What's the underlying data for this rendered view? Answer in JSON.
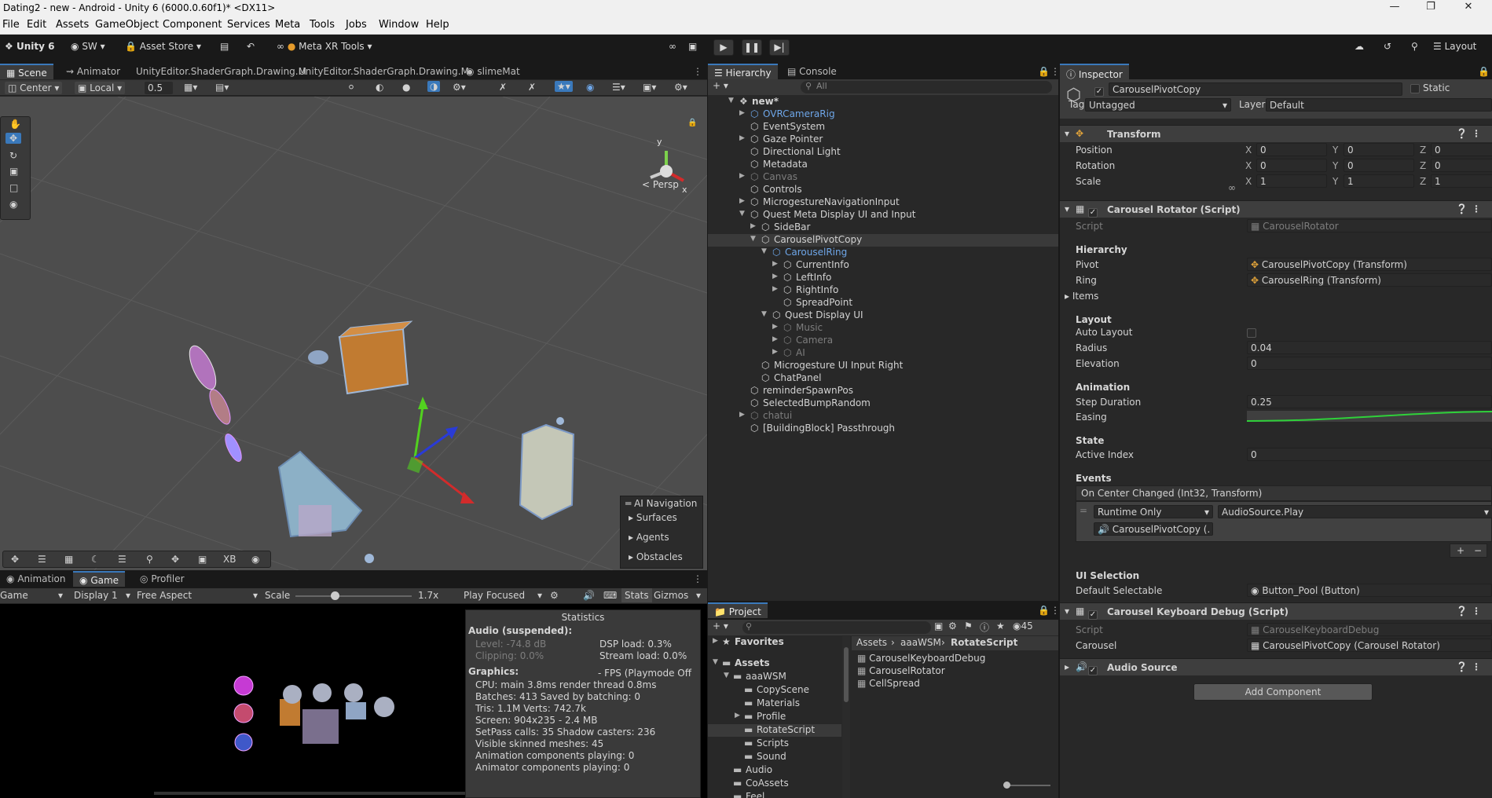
{
  "window": {
    "title": "Dating2 - new - Android - Unity 6 (6000.0.60f1)* <DX11>"
  },
  "menu": [
    "File",
    "Edit",
    "Assets",
    "GameObject",
    "Component",
    "Services",
    "Meta",
    "Tools",
    "Jobs",
    "Window",
    "Help"
  ],
  "toolbar": {
    "unity_label": "Unity 6",
    "account": "SW",
    "asset_store": "Asset Store",
    "meta_xr": "Meta XR Tools",
    "layout": "Layout"
  },
  "scene_tabs": {
    "scene": "Scene",
    "animator": "Animator",
    "shader1": "UnityEditor.ShaderGraph.Drawing.M",
    "shader2": "UnityEditor.ShaderGraph.Drawing.M",
    "slime": "slimeMat"
  },
  "scene_toolbar": {
    "pivot": "Center",
    "space": "Local",
    "snap": "0.5"
  },
  "scene_view": {
    "persp": "< Persp",
    "gizmo_y": "y",
    "gizmo_x": "x",
    "ai_nav_title": "AI Navigation",
    "ai_nav_items": [
      "Surfaces",
      "Agents",
      "Obstacles"
    ],
    "bottom_tool_xb": "XB"
  },
  "game_tabs": {
    "animation": "Animation",
    "game": "Game",
    "profiler": "Profiler"
  },
  "game_toolbar": {
    "mode": "Game",
    "display": "Display 1",
    "aspect": "Free Aspect",
    "scale_label": "Scale",
    "scale_value": "1.7x",
    "play_mode": "Play Focused",
    "stats": "Stats",
    "gizmos": "Gizmos"
  },
  "stats": {
    "title": "Statistics",
    "audio_head": "Audio (suspended):",
    "level": "Level: -74.8 dB",
    "clipping": "Clipping: 0.0%",
    "dsp": "DSP load: 0.3%",
    "stream": "Stream load: 0.0%",
    "graphics_head": "Graphics:",
    "fps": "- FPS (Playmode Off",
    "cpu": "CPU: main 3.8ms  render thread 0.8ms",
    "batches": "Batches: 413     Saved by batching: 0",
    "tris": "Tris: 1.1M   Verts: 742.7k",
    "screen": "Screen: 904x235 - 2.4 MB",
    "setpass": "SetPass calls: 35      Shadow casters: 236",
    "skinned": "Visible skinned meshes: 45",
    "anim": "Animation components playing: 0",
    "animator": "Animator components playing: 0"
  },
  "hierarchy": {
    "tab": "Hierarchy",
    "console_tab": "Console",
    "search_placeholder": "All",
    "items": [
      {
        "label": "new*",
        "indent": 0,
        "arrow": "▼",
        "style": "bold"
      },
      {
        "label": "OVRCameraRig",
        "indent": 1,
        "arrow": "▶",
        "style": "blue"
      },
      {
        "label": "EventSystem",
        "indent": 1,
        "arrow": "",
        "style": ""
      },
      {
        "label": "Gaze Pointer",
        "indent": 1,
        "arrow": "▶",
        "style": ""
      },
      {
        "label": "Directional Light",
        "indent": 1,
        "arrow": "",
        "style": ""
      },
      {
        "label": "Metadata",
        "indent": 1,
        "arrow": "",
        "style": ""
      },
      {
        "label": "Canvas",
        "indent": 1,
        "arrow": "▶",
        "style": "dim"
      },
      {
        "label": "Controls",
        "indent": 1,
        "arrow": "",
        "style": ""
      },
      {
        "label": "MicrogestureNavigationInput",
        "indent": 1,
        "arrow": "▶",
        "style": ""
      },
      {
        "label": "Quest Meta Display UI and Input",
        "indent": 1,
        "arrow": "▼",
        "style": ""
      },
      {
        "label": "SideBar",
        "indent": 2,
        "arrow": "▶",
        "style": ""
      },
      {
        "label": "CarouselPivotCopy",
        "indent": 2,
        "arrow": "▼",
        "style": "sel"
      },
      {
        "label": "CarouselRing",
        "indent": 3,
        "arrow": "▼",
        "style": "blue"
      },
      {
        "label": "CurrentInfo",
        "indent": 4,
        "arrow": "▶",
        "style": ""
      },
      {
        "label": "LeftInfo",
        "indent": 4,
        "arrow": "▶",
        "style": ""
      },
      {
        "label": "RightInfo",
        "indent": 4,
        "arrow": "▶",
        "style": ""
      },
      {
        "label": "SpreadPoint",
        "indent": 4,
        "arrow": "",
        "style": ""
      },
      {
        "label": "Quest Display UI",
        "indent": 3,
        "arrow": "▼",
        "style": ""
      },
      {
        "label": "Music",
        "indent": 4,
        "arrow": "▶",
        "style": "dim"
      },
      {
        "label": "Camera",
        "indent": 4,
        "arrow": "▶",
        "style": "dim"
      },
      {
        "label": "AI",
        "indent": 4,
        "arrow": "▶",
        "style": "dim"
      },
      {
        "label": "Microgesture UI Input Right",
        "indent": 2,
        "arrow": "",
        "style": ""
      },
      {
        "label": "ChatPanel",
        "indent": 2,
        "arrow": "",
        "style": ""
      },
      {
        "label": "reminderSpawnPos",
        "indent": 1,
        "arrow": "",
        "style": ""
      },
      {
        "label": "SelectedBumpRandom",
        "indent": 1,
        "arrow": "",
        "style": ""
      },
      {
        "label": "chatui",
        "indent": 1,
        "arrow": "▶",
        "style": "dim"
      },
      {
        "label": "[BuildingBlock] Passthrough",
        "indent": 1,
        "arrow": "",
        "style": ""
      }
    ]
  },
  "project": {
    "tab": "Project",
    "count": "45",
    "tree": [
      {
        "label": "Favorites",
        "indent": 0,
        "arrow": "▶",
        "style": "bold"
      },
      {
        "label": "Assets",
        "indent": 0,
        "arrow": "▼",
        "style": "bold"
      },
      {
        "label": "aaaWSM",
        "indent": 1,
        "arrow": "▼",
        "style": ""
      },
      {
        "label": "CopyScene",
        "indent": 2,
        "arrow": "",
        "style": ""
      },
      {
        "label": "Materials",
        "indent": 2,
        "arrow": "",
        "style": ""
      },
      {
        "label": "Profile",
        "indent": 2,
        "arrow": "▶",
        "style": ""
      },
      {
        "label": "RotateScript",
        "indent": 2,
        "arrow": "",
        "style": "sel"
      },
      {
        "label": "Scripts",
        "indent": 2,
        "arrow": "",
        "style": ""
      },
      {
        "label": "Sound",
        "indent": 2,
        "arrow": "",
        "style": ""
      },
      {
        "label": "Audio",
        "indent": 1,
        "arrow": "",
        "style": ""
      },
      {
        "label": "CoAssets",
        "indent": 1,
        "arrow": "",
        "style": ""
      },
      {
        "label": "Feel",
        "indent": 1,
        "arrow": "",
        "style": ""
      }
    ],
    "breadcrumb": [
      "Assets",
      "aaaWSM",
      "RotateScript"
    ],
    "files": [
      "CarouselKeyboardDebug",
      "CarouselRotator",
      "CellSpread"
    ]
  },
  "inspector": {
    "tab": "Inspector",
    "object_name": "CarouselPivotCopy",
    "static_label": "Static",
    "tag_label": "Tag",
    "tag_value": "Untagged",
    "layer_label": "Layer",
    "layer_value": "Default",
    "transform": {
      "title": "Transform",
      "rows": [
        {
          "label": "Position",
          "x": "0",
          "y": "0",
          "z": "0"
        },
        {
          "label": "Rotation",
          "x": "0",
          "y": "0",
          "z": "0"
        },
        {
          "label": "Scale",
          "x": "1",
          "y": "1",
          "z": "1"
        }
      ]
    },
    "rotator": {
      "title": "Carousel Rotator (Script)",
      "script_label": "Script",
      "script_value": "CarouselRotator",
      "hierarchy_head": "Hierarchy",
      "pivot_label": "Pivot",
      "pivot_value": "CarouselPivotCopy (Transform)",
      "ring_label": "Ring",
      "ring_value": "CarouselRing (Transform)",
      "items_label": "Items",
      "layout_head": "Layout",
      "auto_layout_label": "Auto Layout",
      "radius_label": "Radius",
      "radius_value": "0.04",
      "elevation_label": "Elevation",
      "elevation_value": "0",
      "animation_head": "Animation",
      "step_label": "Step Duration",
      "step_value": "0.25",
      "easing_label": "Easing",
      "state_head": "State",
      "active_label": "Active Index",
      "active_value": "0",
      "events_head": "Events",
      "event_name": "On Center Changed (Int32, Transform)",
      "runtime": "Runtime Only",
      "func": "AudioSource.Play",
      "target": "CarouselPivotCopy (.",
      "ui_head": "UI Selection",
      "default_sel_label": "Default Selectable",
      "default_sel_value": "Button_Pool (Button)"
    },
    "keyboard": {
      "title": "Carousel Keyboard Debug (Script)",
      "script_label": "Script",
      "script_value": "CarouselKeyboardDebug",
      "carousel_label": "Carousel",
      "carousel_value": "CarouselPivotCopy (Carousel Rotator)"
    },
    "audio": {
      "title": "Audio Source"
    },
    "add_component": "Add Component"
  }
}
